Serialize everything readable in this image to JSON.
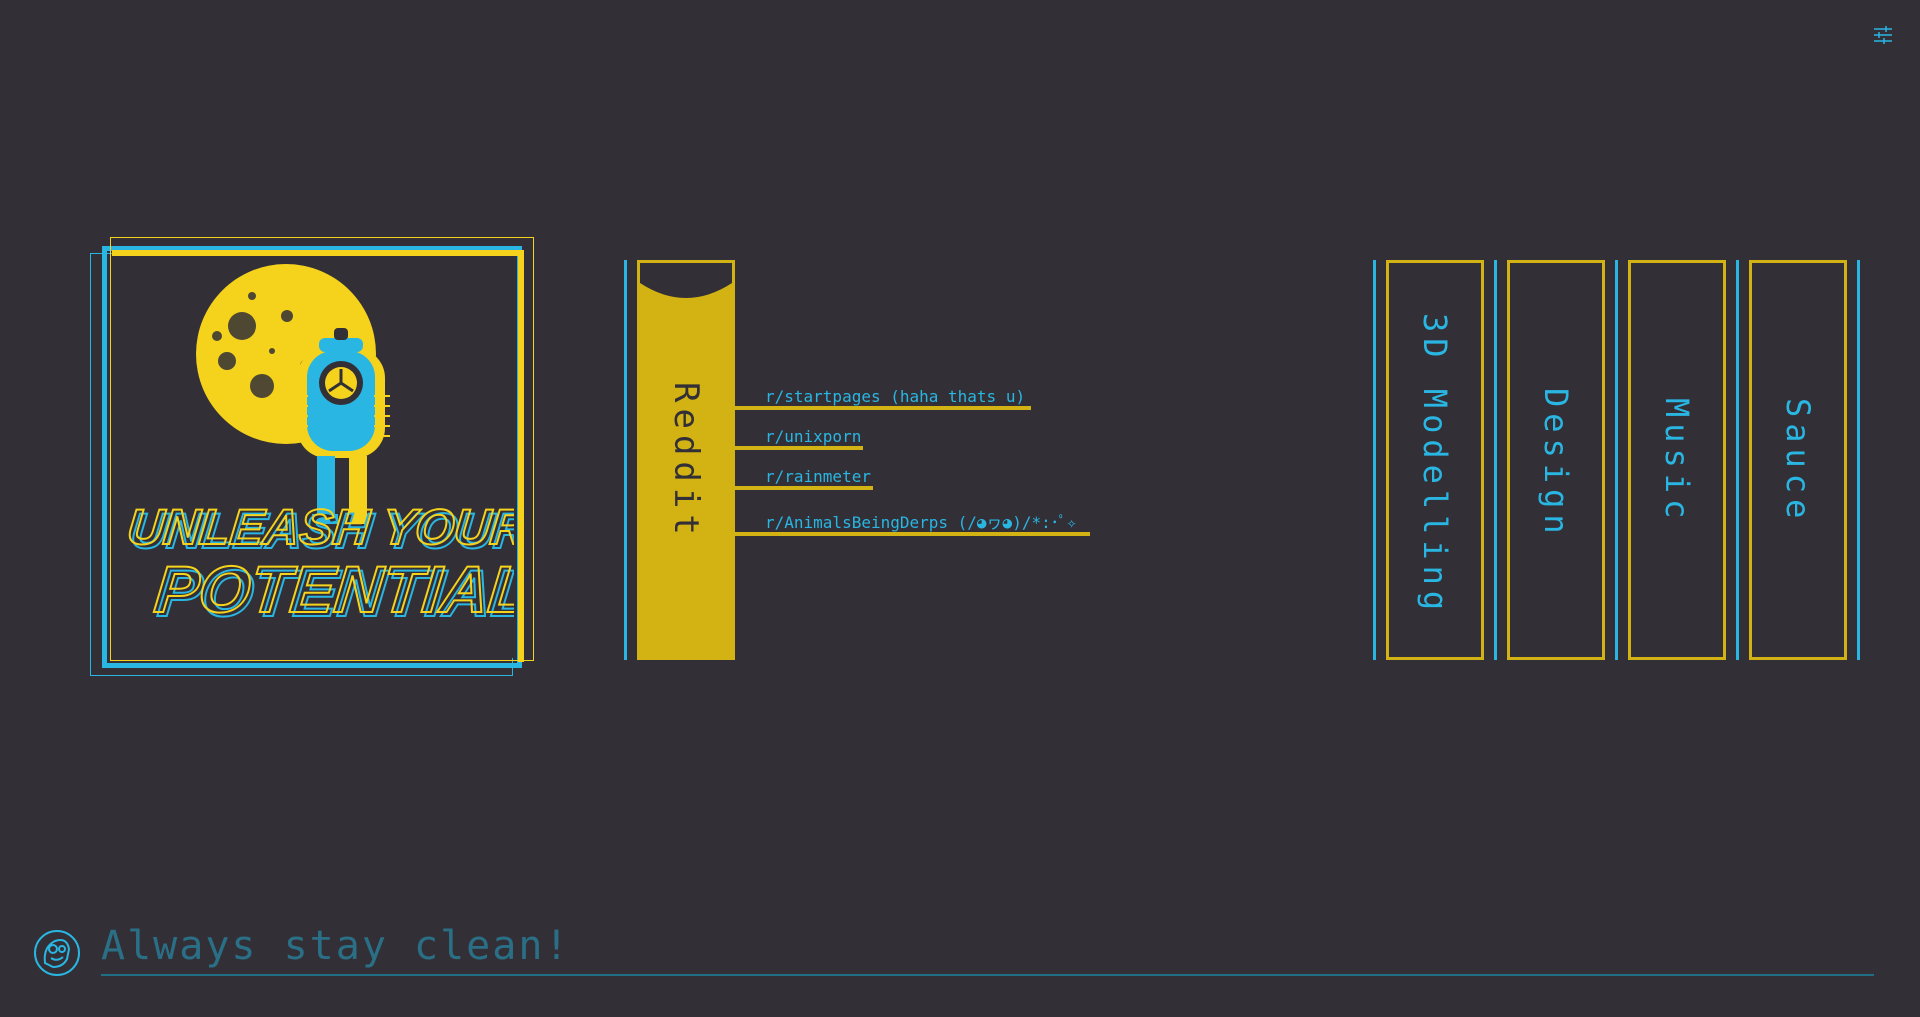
{
  "colors": {
    "background": "#323036",
    "accent_blue": "#29b6e3",
    "accent_yellow": "#d3b213"
  },
  "poster": {
    "line1": "UNLEASH YOUR",
    "line2": "POTENTIAL"
  },
  "reddit": {
    "label": "Reddit",
    "links": [
      {
        "text": "r/startpages (haha thats u)"
      },
      {
        "text": "r/unixporn"
      },
      {
        "text": "r/rainmeter"
      },
      {
        "text": "r/AnimalsBeingDerps (/◕ヮ◕)/*:･ﾟ✧"
      }
    ]
  },
  "categories": [
    {
      "label": "3D Modelling"
    },
    {
      "label": "Design"
    },
    {
      "label": "Music"
    },
    {
      "label": "Sauce"
    }
  ],
  "search": {
    "placeholder": "Always stay clean!"
  },
  "icons": {
    "settings": "sliders-icon",
    "avatar": "avatar-icon"
  }
}
